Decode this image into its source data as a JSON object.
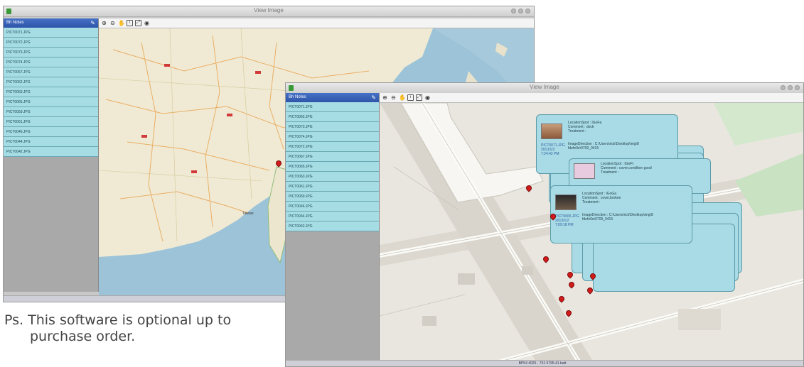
{
  "window": {
    "title": "View Image"
  },
  "sidebar": {
    "header": "Bh Notes",
    "items_back": [
      "PICT0071.JPG",
      "PICT0072.JPG",
      "PICT0073.JPG",
      "PICT0074.JPG",
      "PICT0067.JPG",
      "PICT0062.JPG",
      "PICT0063.JPG",
      "PICT0065.JPG",
      "PICT0059.JPG",
      "PICT0061.JPG",
      "PICT0046.JPG",
      "PICT0044.JPG",
      "PICT0042.JPG"
    ],
    "items_front": [
      "PICT0071.JPG",
      "PICT0062.JPG",
      "PICT0073.JPG",
      "PICT0074.JPG",
      "PICT0072.JPG",
      "PICT0067.JPG",
      "PICT0065.JPG",
      "PICT0063.JPG",
      "PICT0061.JPG",
      "PICT0059.JPG",
      "PICT0046.JPG",
      "PICT0044.JPG",
      "PICT0042.JPG"
    ]
  },
  "toolbar": {
    "icons": [
      "zoom-in-icon",
      "zoom-out-icon",
      "pan-hand-icon",
      "info-icon",
      "fit-icon",
      "globe-icon"
    ]
  },
  "status": {
    "back": "BP54 4026 · 776.6063.4",
    "front": "BP54 4026 · 761 5795.41 batt"
  },
  "map_back": {
    "labels": [
      "Taiwan"
    ]
  },
  "callouts": [
    {
      "lines": "LocationSpot : IGoFa\nComment : dock\nTreatment :",
      "lines2": "ImageDirection : C:\\Users\\rick\\Desktop\\img\\8\nfdefe0e\\0709_0415",
      "fname": "PICT0071.JPG\n2013/1/2\n7:24:42 PM"
    },
    {
      "lines": "LocationSpot : IGoFt\nComment : cover,condition good\nTreatment :",
      "lines2": "",
      "fname": ""
    },
    {
      "lines": "LocationSpot : IGoGa\nComment : cover,broken\nTreatment :",
      "lines2": "ImageDirection : C:\\Users\\rick\\Desktop\\img\\8\nfdefe0e\\0709_0415",
      "fname": "PICT0065.JPG\n2013/1/2\n7:09:18 PM"
    }
  ],
  "caption": {
    "line1": "Ps. This software is optional up to",
    "line2": "purchase order."
  },
  "colors": {
    "accent": "#2e55a8",
    "list_item": "#a6dde5",
    "callout": "#a9dbe6",
    "pin": "#d21a1a"
  }
}
